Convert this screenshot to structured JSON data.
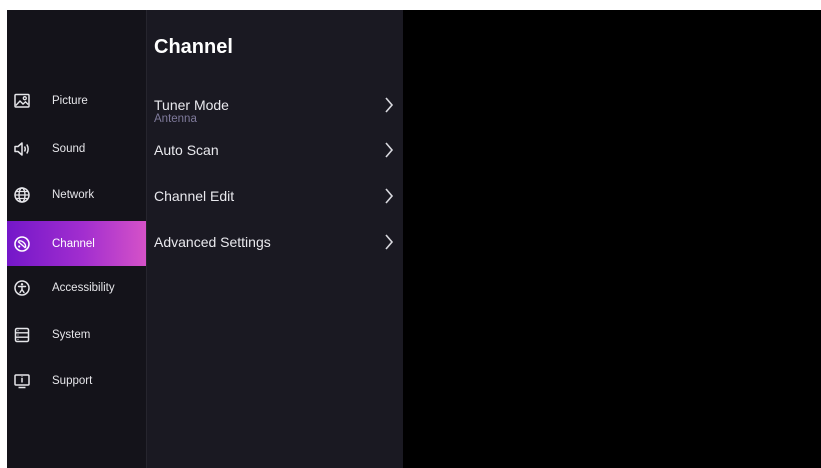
{
  "panel": {
    "title": "Channel",
    "items": [
      {
        "label": "Tuner Mode",
        "value": "Antenna"
      },
      {
        "label": "Auto Scan"
      },
      {
        "label": "Channel Edit"
      },
      {
        "label": "Advanced Settings"
      }
    ]
  },
  "sidebar": {
    "items": [
      {
        "label": "Picture",
        "icon": "picture-icon"
      },
      {
        "label": "Sound",
        "icon": "speaker-icon"
      },
      {
        "label": "Network",
        "icon": "globe-icon"
      },
      {
        "label": "Channel",
        "icon": "channel-icon",
        "selected": true
      },
      {
        "label": "Accessibility",
        "icon": "accessibility-icon"
      },
      {
        "label": "System",
        "icon": "system-icon"
      },
      {
        "label": "Support",
        "icon": "support-icon"
      }
    ]
  },
  "colors": {
    "selected_gradient_start": "#7417c9",
    "selected_gradient_end": "#d552c8",
    "sidebar_bg": "#14131a",
    "panel_bg": "#1a1922",
    "subtext": "#7f7a9b"
  }
}
